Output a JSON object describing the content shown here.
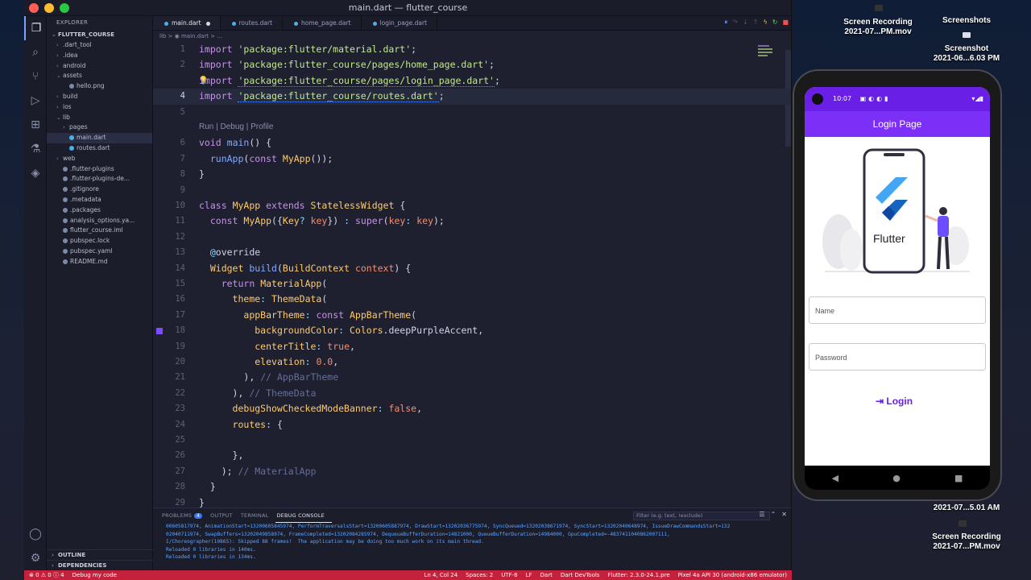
{
  "window": {
    "title": "main.dart — flutter_course"
  },
  "sidebar": {
    "header": "EXPLORER",
    "project": "FLUTTER_COURSE",
    "items": [
      {
        "label": ".dart_tool",
        "indent": 1,
        "kind": "folder"
      },
      {
        "label": ".idea",
        "indent": 1,
        "kind": "folder"
      },
      {
        "label": "android",
        "indent": 1,
        "kind": "folder"
      },
      {
        "label": "assets",
        "indent": 1,
        "kind": "folder-open"
      },
      {
        "label": "hello.png",
        "indent": 2,
        "kind": "file"
      },
      {
        "label": "build",
        "indent": 1,
        "kind": "folder"
      },
      {
        "label": "ios",
        "indent": 1,
        "kind": "folder"
      },
      {
        "label": "lib",
        "indent": 1,
        "kind": "folder-open"
      },
      {
        "label": "pages",
        "indent": 2,
        "kind": "folder"
      },
      {
        "label": "main.dart",
        "indent": 2,
        "kind": "dart",
        "selected": true
      },
      {
        "label": "routes.dart",
        "indent": 2,
        "kind": "dart"
      },
      {
        "label": "web",
        "indent": 1,
        "kind": "folder"
      },
      {
        "label": ".flutter-plugins",
        "indent": 1,
        "kind": "file"
      },
      {
        "label": ".flutter-plugins-de...",
        "indent": 1,
        "kind": "file"
      },
      {
        "label": ".gitignore",
        "indent": 1,
        "kind": "file"
      },
      {
        "label": ".metadata",
        "indent": 1,
        "kind": "file"
      },
      {
        "label": ".packages",
        "indent": 1,
        "kind": "file"
      },
      {
        "label": "analysis_options.ya...",
        "indent": 1,
        "kind": "file"
      },
      {
        "label": "flutter_course.iml",
        "indent": 1,
        "kind": "file"
      },
      {
        "label": "pubspec.lock",
        "indent": 1,
        "kind": "file"
      },
      {
        "label": "pubspec.yaml",
        "indent": 1,
        "kind": "file"
      },
      {
        "label": "README.md",
        "indent": 1,
        "kind": "file"
      }
    ],
    "outline": "OUTLINE",
    "dependencies": "DEPENDENCIES"
  },
  "tabs": [
    {
      "label": "main.dart",
      "active": true
    },
    {
      "label": "routes.dart"
    },
    {
      "label": "home_page.dart"
    },
    {
      "label": "login_page.dart"
    }
  ],
  "breadcrumb": "lib > ◉ main.dart > ...",
  "codelens": "Run | Debug | Profile",
  "code_lines": [
    {
      "n": "1",
      "html": "<span class='k'>import</span> <span class='s'>'package:flutter/material.dart'</span><span class='w'>;</span>"
    },
    {
      "n": "2",
      "html": "<span class='k'>import</span> <span class='s'>'package:flutter_course/pages/home_page.dart'</span><span class='w'>;</span>"
    },
    {
      "n": "",
      "html": "<span class='k'>import</span> <span class='s squig'>'package:flutter_course/pages/login_page.dart'</span><span class='w'>;</span>"
    },
    {
      "n": "4",
      "html": "<span class='k'>import</span> <span class='s squig'>'package:flutter_course/routes.dart'</span><span class='w'>;</span>"
    },
    {
      "n": "5",
      "html": ""
    },
    {
      "n": "6",
      "html": "<span class='k'>void</span> <span class='f'>main</span><span class='w'>() {</span>"
    },
    {
      "n": "7",
      "html": "  <span class='f'>runApp</span><span class='w'>(</span><span class='k'>const</span> <span class='t'>MyApp</span><span class='w'>());</span>"
    },
    {
      "n": "8",
      "html": "<span class='w'>}</span>"
    },
    {
      "n": "9",
      "html": ""
    },
    {
      "n": "10",
      "html": "<span class='k'>class</span> <span class='t'>MyApp</span> <span class='k'>extends</span> <span class='t'>StatelessWidget</span> <span class='w'>{</span>"
    },
    {
      "n": "11",
      "html": "  <span class='k'>const</span> <span class='t'>MyApp</span><span class='w'>({</span><span class='t'>Key</span><span class='p'>?</span> <span class='v'>key</span><span class='w'>}) </span><span class='p'>:</span> <span class='k'>super</span><span class='w'>(</span><span class='v'>key</span><span class='p'>:</span> <span class='v'>key</span><span class='w'>);</span>"
    },
    {
      "n": "12",
      "html": ""
    },
    {
      "n": "13",
      "html": "  <span class='p'>@</span><span class='w'>override</span>"
    },
    {
      "n": "14",
      "html": "  <span class='t'>Widget</span> <span class='f'>build</span><span class='w'>(</span><span class='t'>BuildContext</span> <span class='v'>context</span><span class='w'>) {</span>"
    },
    {
      "n": "15",
      "html": "    <span class='k'>return</span> <span class='t'>MaterialApp</span><span class='w'>(</span>"
    },
    {
      "n": "16",
      "html": "      <span class='t'>theme</span><span class='p'>:</span> <span class='t'>ThemeData</span><span class='w'>(</span>"
    },
    {
      "n": "17",
      "html": "        <span class='t'>appBarTheme</span><span class='p'>:</span> <span class='k'>const</span> <span class='t'>AppBarTheme</span><span class='w'>(</span>"
    },
    {
      "n": "18",
      "html": "          <span class='t'>backgroundColor</span><span class='p'>:</span> <span class='t'>Colors</span><span class='w'>.deepPurpleAccent,</span>"
    },
    {
      "n": "19",
      "html": "          <span class='t'>centerTitle</span><span class='p'>:</span> <span class='v'>true</span><span class='w'>,</span>"
    },
    {
      "n": "20",
      "html": "          <span class='t'>elevation</span><span class='p'>:</span> <span class='v'>0.0</span><span class='w'>,</span>"
    },
    {
      "n": "21",
      "html": "        <span class='w'>),</span> <span class='c'>// AppBarTheme</span>"
    },
    {
      "n": "22",
      "html": "      <span class='w'>),</span> <span class='c'>// ThemeData</span>"
    },
    {
      "n": "23",
      "html": "      <span class='t'>debugShowCheckedModeBanner</span><span class='p'>:</span> <span class='v'>false</span><span class='w'>,</span>"
    },
    {
      "n": "24",
      "html": "      <span class='t'>routes</span><span class='p'>:</span> <span class='w'>{</span>"
    },
    {
      "n": "25",
      "html": ""
    },
    {
      "n": "26",
      "html": "      <span class='w'>},</span>"
    },
    {
      "n": "27",
      "html": "    <span class='w'>);</span> <span class='c'>// MaterialApp</span>"
    },
    {
      "n": "28",
      "html": "  <span class='w'>}</span>"
    },
    {
      "n": "29",
      "html": "<span class='w'>}</span>"
    }
  ],
  "panel": {
    "tabs": [
      "PROBLEMS",
      "OUTPUT",
      "TERMINAL",
      "DEBUG CONSOLE"
    ],
    "problems_count": "4",
    "filter_placeholder": "Filter (e.g. text, !exclude)",
    "log": [
      "00605817974, AnimationStart=13200605845974, PerformTraversalsStart=13200605887974, DrawStart=13202036775974, SyncQueued=13202038671974, SyncStart=13202040648974, IssueDrawCommandsStart=132",
      "02040711974, SwapBuffers=13202049858974, FrameCompleted=13202084285974, DequeueBufferDuration=14821000, QueueBufferDuration=14984000, GpuCompleted=-4837411040862007111,",
      "I/Choreographer(10865): Skipped 88 frames!  The application may be doing too much work on its main thread.",
      "Reloaded 0 libraries in 140ms.",
      "Reloaded 0 libraries in 134ms."
    ]
  },
  "statusbar": {
    "errors": "⊗ 0 ⚠ 0 ⓘ 4",
    "debug": "Debug my code",
    "position": "Ln 4, Col 24",
    "spaces": "Spaces: 2",
    "encoding": "UTF-8",
    "eol": "LF",
    "language": "Dart",
    "devtools": "Dart DevTools",
    "flutter": "Flutter: 2.3.0-24.1.pre",
    "device": "Pixel 4a API 30 (android-x86 emulator)"
  },
  "desktop": {
    "rec1": {
      "line1": "Screen Recording",
      "line2": "2021-07...PM.mov"
    },
    "shots": {
      "line1": "Screenshots"
    },
    "shot": {
      "line1": "Screenshot",
      "line2": "2021-06...6.03 PM"
    },
    "rec2_date": "2021-07...5.01 AM",
    "rec3": {
      "line1": "Screen Recording",
      "line2": "2021-07...PM.mov"
    }
  },
  "phone": {
    "time": "10:07",
    "appbar_title": "Login Page",
    "illustration_text": "Flutter",
    "name_placeholder": "Name",
    "password_placeholder": "Password",
    "login_label": "Login",
    "accent": "#7b2ff7"
  },
  "colors": {
    "statusbar": "#c4213d",
    "editor_bg": "#1e2030"
  }
}
